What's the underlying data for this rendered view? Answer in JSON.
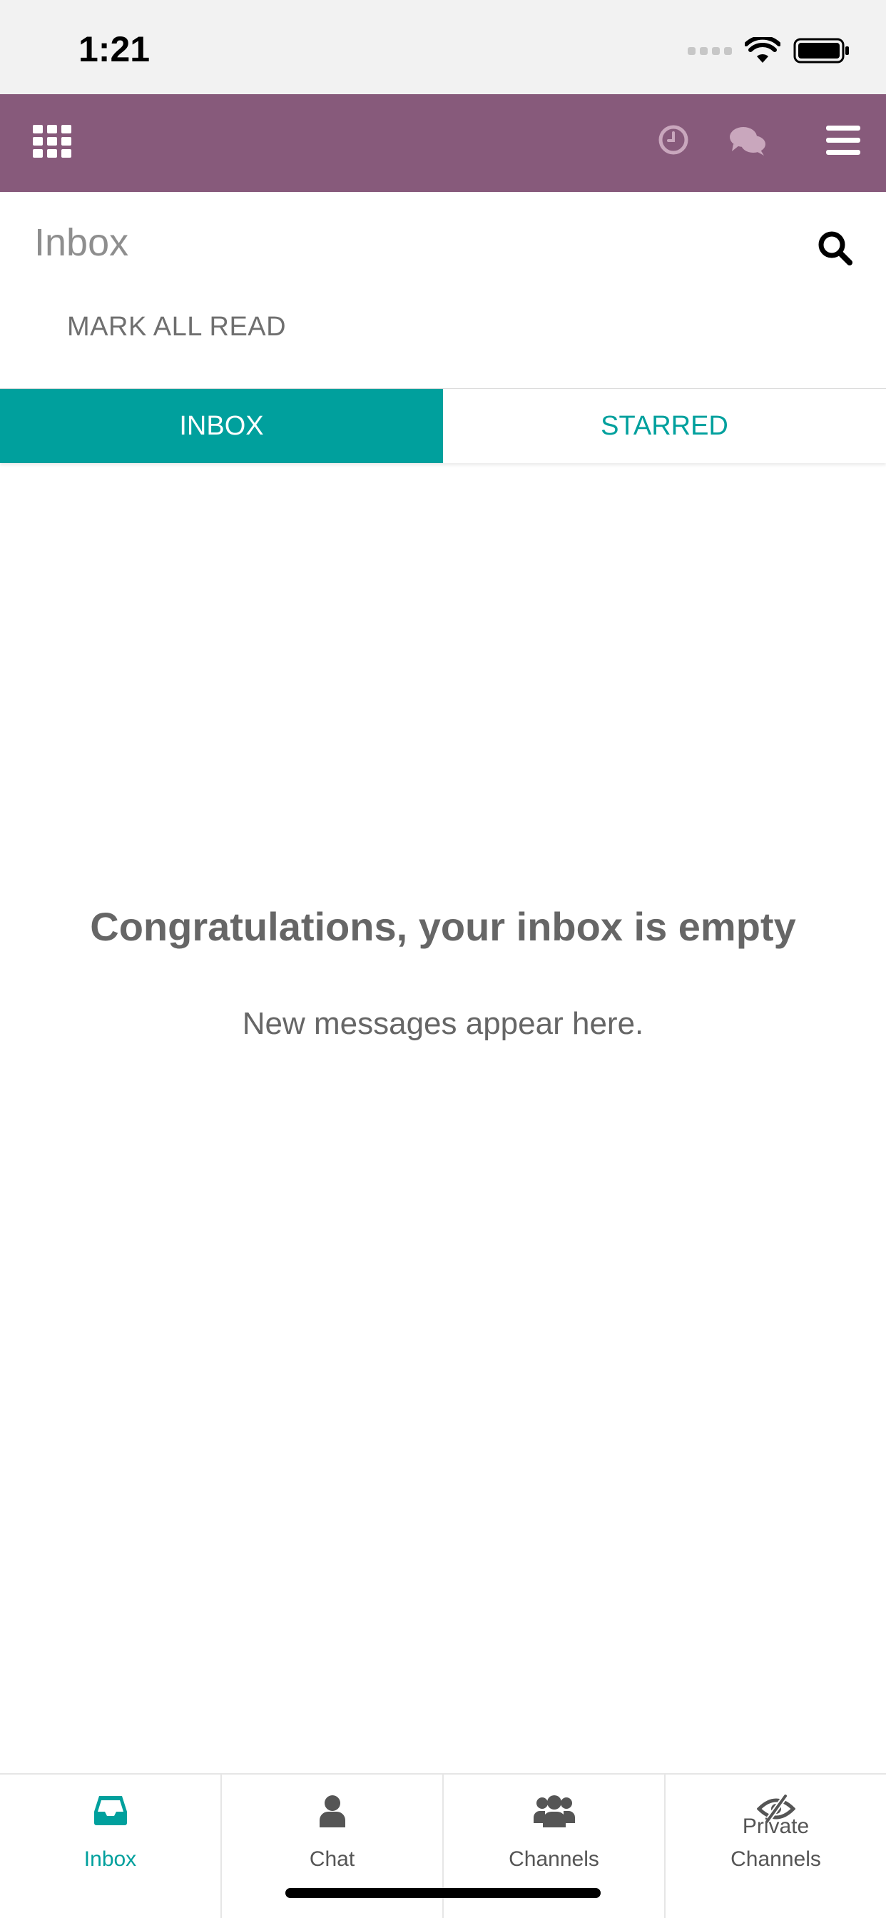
{
  "status_bar": {
    "time": "1:21"
  },
  "header": {
    "page_title": "Inbox",
    "mark_all_read_label": "MARK ALL READ"
  },
  "tabs": [
    {
      "label": "INBOX",
      "active": true
    },
    {
      "label": "STARRED",
      "active": false
    }
  ],
  "empty_state": {
    "title": "Congratulations, your inbox is empty",
    "subtitle": "New messages appear here."
  },
  "bottom_nav": [
    {
      "label": "Inbox",
      "icon": "inbox-icon",
      "active": true
    },
    {
      "label": "Chat",
      "icon": "user-icon",
      "active": false
    },
    {
      "label": "Channels",
      "icon": "users-icon",
      "active": false
    },
    {
      "label": "Private\nChannels",
      "icon": "eye-slash-icon",
      "active": false
    }
  ],
  "colors": {
    "topbar": "#875a7b",
    "accent": "#00a09d",
    "topbar_icons_muted": "#c9a7bd"
  },
  "icons": [
    "apps-icon",
    "clock-icon",
    "chat-icon",
    "menu-icon",
    "search-icon",
    "wifi-icon",
    "battery-icon"
  ]
}
